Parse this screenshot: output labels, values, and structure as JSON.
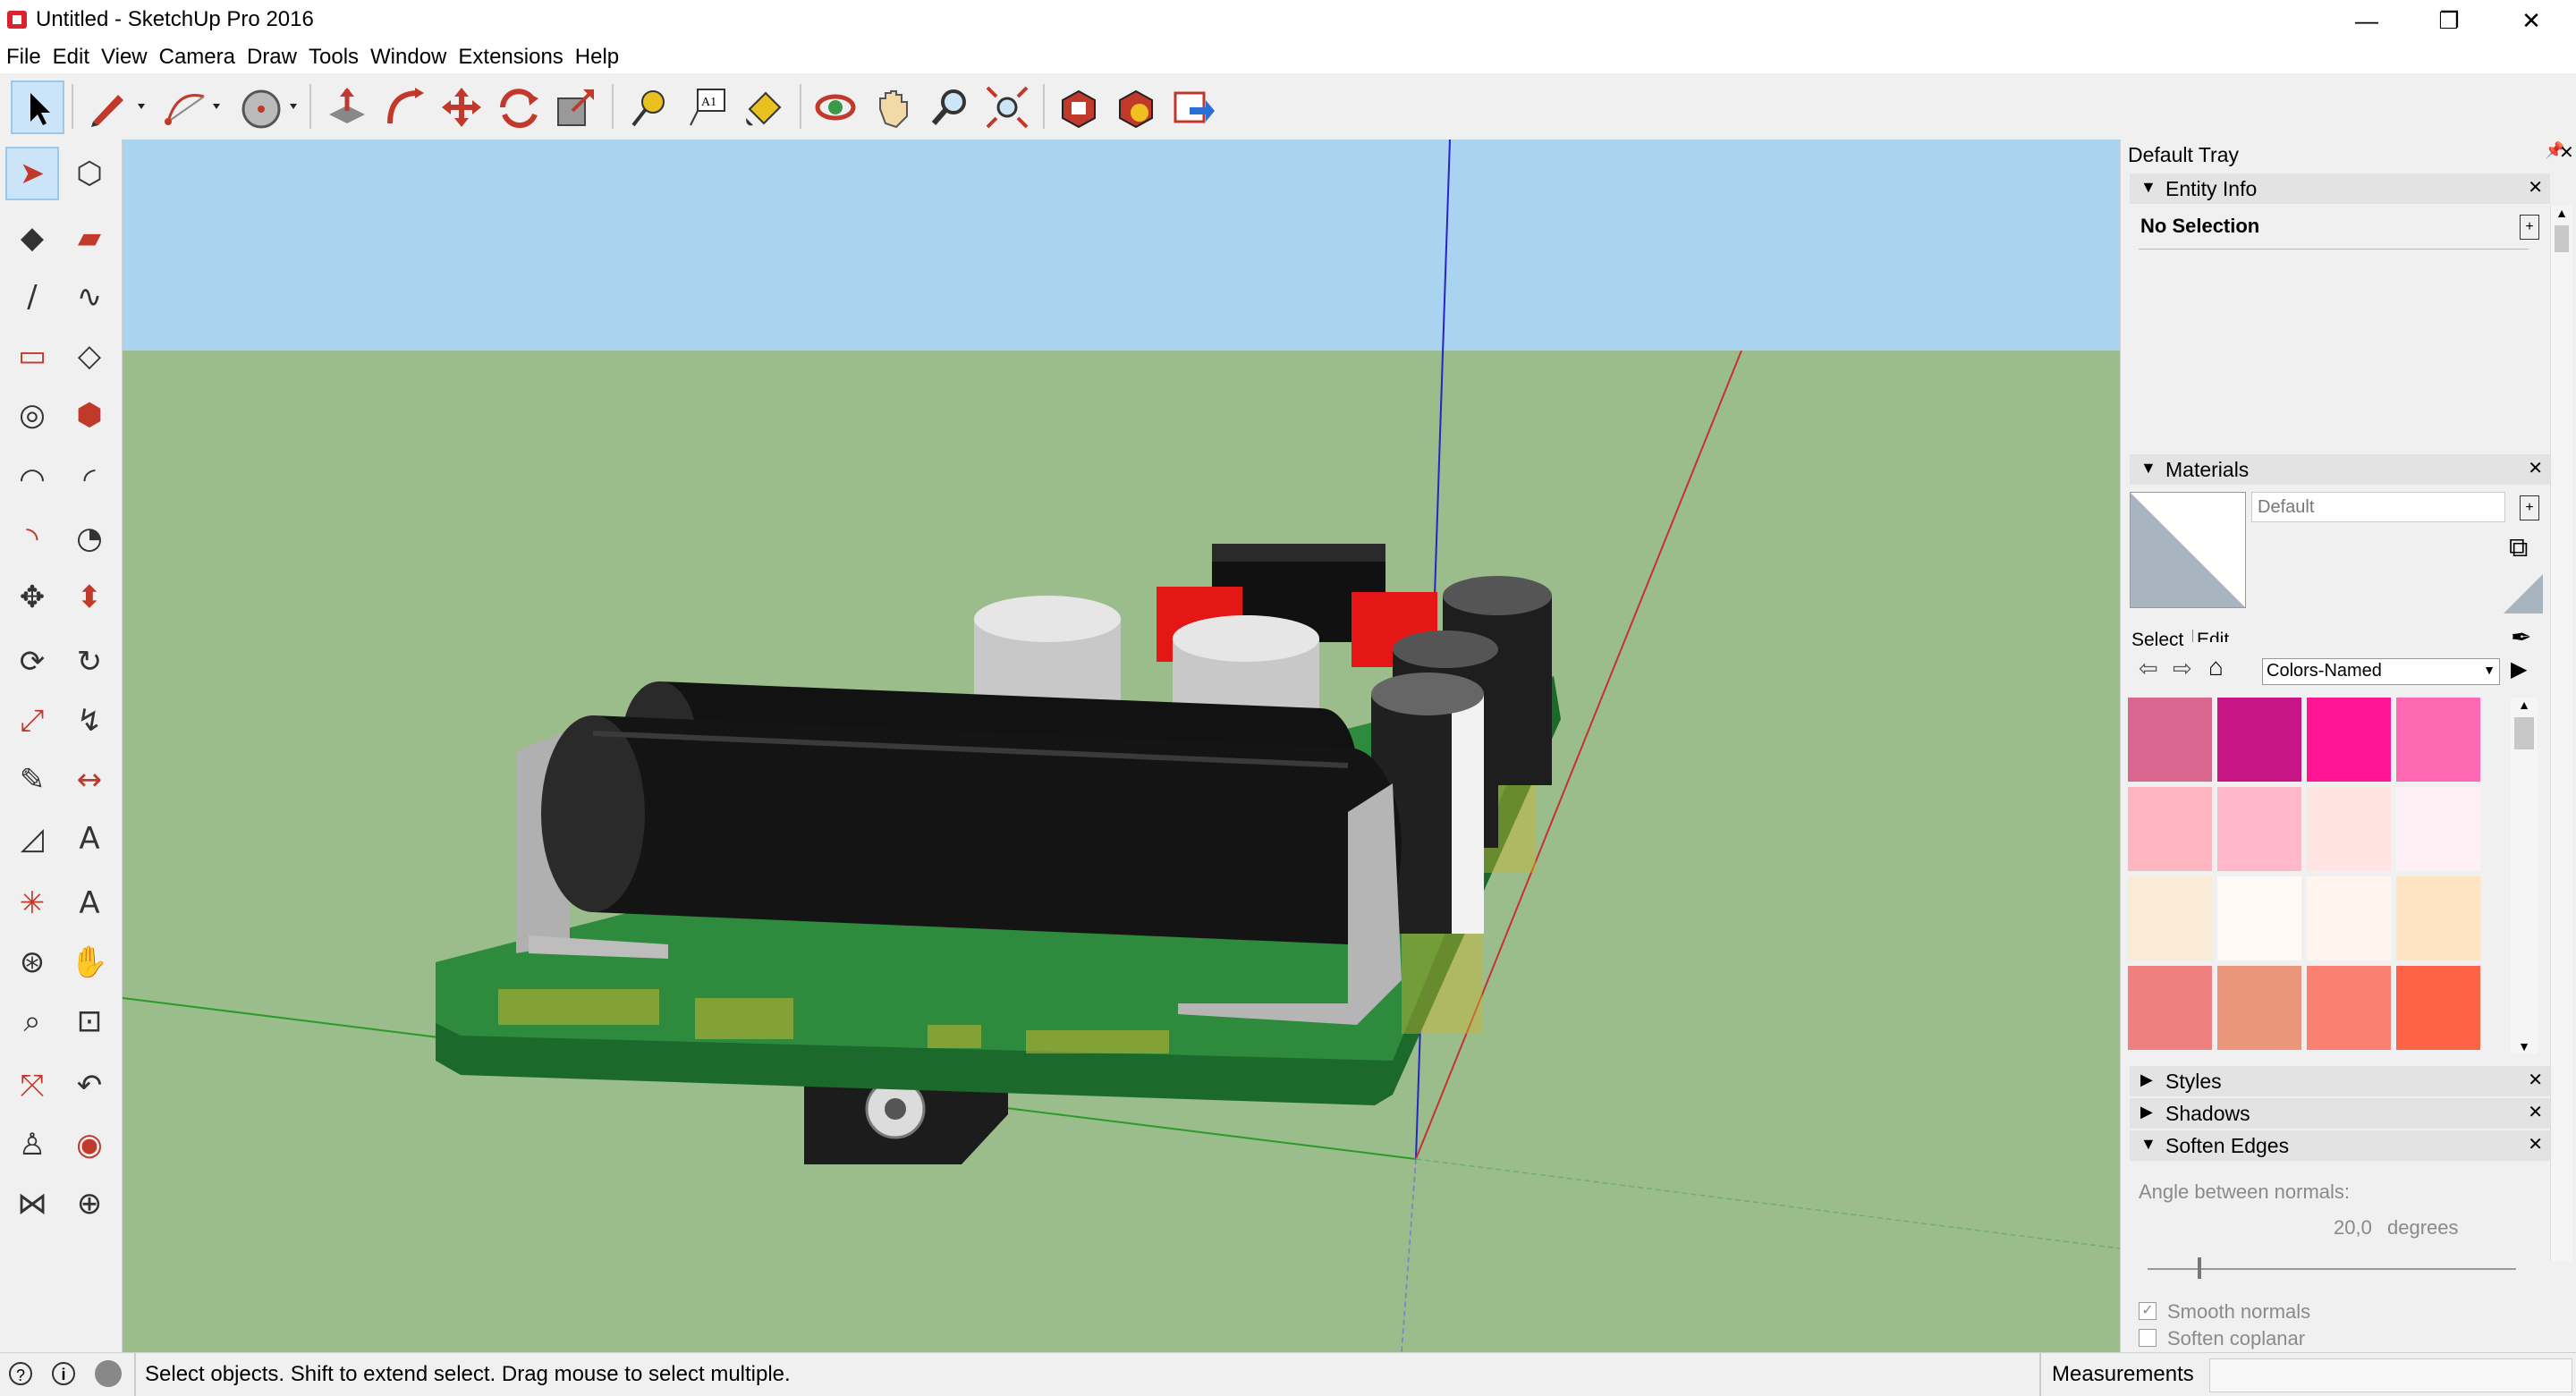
{
  "window": {
    "title": "Untitled - SketchUp Pro 2016",
    "minimize": "—",
    "restore": "❐",
    "close": "✕"
  },
  "menu": [
    "File",
    "Edit",
    "View",
    "Camera",
    "Draw",
    "Tools",
    "Window",
    "Extensions",
    "Help"
  ],
  "toolbar": {
    "icons": [
      "select-icon",
      "pencil-icon",
      "arc-icon",
      "circle-icon",
      "push-pull-icon",
      "follow-me-icon",
      "move-icon",
      "rotate-icon",
      "scale-icon",
      "tape-measure-icon",
      "text-icon",
      "paint-bucket-icon",
      "orbit-icon",
      "pan-icon",
      "zoom-icon",
      "zoom-extents-icon",
      "warehouse-icon",
      "extension-warehouse-icon",
      "send-to-layout-icon"
    ]
  },
  "left_palette": {
    "icons": [
      "select-icon",
      "component-icon",
      "paint-bucket-icon",
      "eraser-icon",
      "line-icon",
      "freehand-icon",
      "rectangle-icon",
      "rotated-rectangle-icon",
      "circle-icon",
      "polygon-icon",
      "arc-icon",
      "two-point-arc-icon",
      "three-point-arc-icon",
      "pie-icon",
      "move-icon",
      "push-pull-icon",
      "rotate-icon",
      "follow-me-icon",
      "scale-icon",
      "offset-icon",
      "tape-measure-icon",
      "dimension-icon",
      "protractor-icon",
      "text-icon",
      "axes-icon",
      "3d-text-icon",
      "orbit-icon",
      "pan-icon",
      "zoom-icon",
      "zoom-window-icon",
      "zoom-extents-icon",
      "previous-view-icon",
      "position-camera-icon",
      "look-around-icon",
      "walk-icon",
      "section-plane-icon"
    ]
  },
  "tray": {
    "title": "Default Tray",
    "entity_info": {
      "label": "Entity Info",
      "selection": "No Selection"
    },
    "materials": {
      "label": "Materials",
      "name_value": "Default",
      "tabs": [
        "Select",
        "Edit"
      ],
      "library": "Colors-Named",
      "swatches": [
        "#d9668f",
        "#c71585",
        "#ff1493",
        "#ff69b4",
        "#ffb6c1",
        "#ffb7c9",
        "#ffe4e1",
        "#fff0f5",
        "#faebd7",
        "#fffaf5",
        "#fff5ee",
        "#ffe4c4",
        "#f08080",
        "#e9967a",
        "#fa8072",
        "#ff6347"
      ]
    },
    "styles_label": "Styles",
    "shadows_label": "Shadows",
    "soften": {
      "label": "Soften Edges",
      "angle_label": "Angle between normals:",
      "angle_value": "20,0",
      "angle_unit": "degrees",
      "smooth": "Smooth normals",
      "coplanar": "Soften coplanar"
    }
  },
  "status": {
    "message": "Select objects. Shift to extend select. Drag mouse to select multiple.",
    "measurements_label": "Measurements"
  },
  "colors": {
    "sky": "#a9d3ef",
    "ground": "#9bbd8c",
    "pcb": "#2e8b3e",
    "battery": "#1a1a1a"
  }
}
